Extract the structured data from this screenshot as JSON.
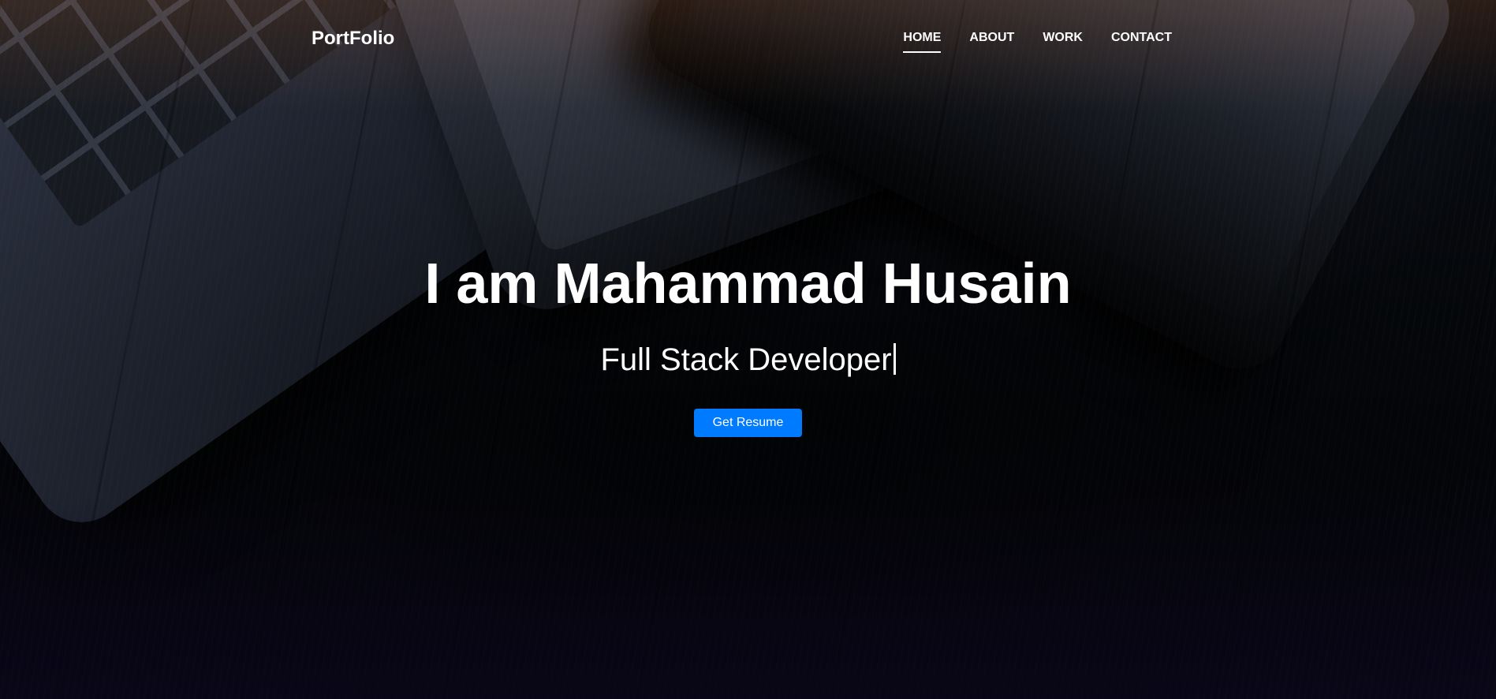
{
  "nav": {
    "brand": "PortFolio",
    "links": [
      {
        "label": "HOME",
        "active": true
      },
      {
        "label": "ABOUT",
        "active": false
      },
      {
        "label": "WORK",
        "active": false
      },
      {
        "label": "CONTACT",
        "active": false
      }
    ]
  },
  "hero": {
    "title": "I am Mahammad Husain",
    "subtitle": "Full Stack Developer",
    "button_label": "Get Resume"
  },
  "colors": {
    "button": "#007bff",
    "text": "#ffffff"
  }
}
